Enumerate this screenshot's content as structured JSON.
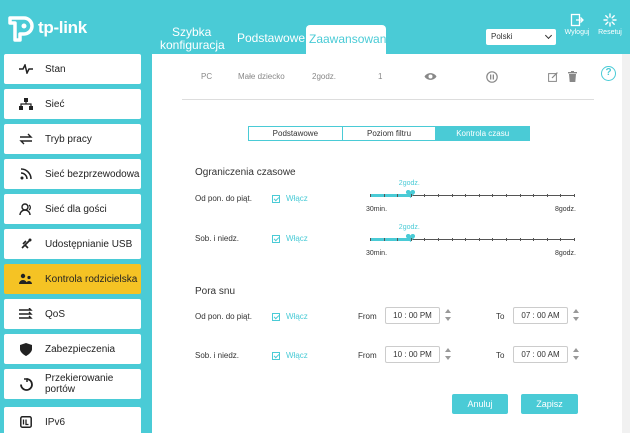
{
  "header": {
    "logo_text": "tp-link",
    "nav": {
      "quick_line1": "Szybka",
      "quick_line2": "konfiguracja",
      "basic": "Podstawowe",
      "advanced": "Zaawansowane"
    },
    "language": "Polski",
    "logout_label": "Wyloguj",
    "reboot_label": "Resetuj"
  },
  "sidebar": {
    "items": [
      {
        "label": "Stan",
        "icon": "pulse-icon"
      },
      {
        "label": "Sieć",
        "icon": "network-icon"
      },
      {
        "label": "Tryb pracy",
        "icon": "mode-icon"
      },
      {
        "label": "Sieć bezprzewodowa",
        "icon": "wifi-icon"
      },
      {
        "label": "Sieć dla gości",
        "icon": "guests-icon"
      },
      {
        "label": "Udostępnianie USB",
        "icon": "usb-icon"
      },
      {
        "label": "Kontrola rodzicielska",
        "icon": "parental-icon"
      },
      {
        "label": "QoS",
        "icon": "qos-icon"
      },
      {
        "label": "Zabezpieczenia",
        "icon": "shield-icon"
      },
      {
        "label_line1": "Przekierowanie",
        "label_line2": "portów",
        "icon": "forward-icon"
      },
      {
        "label": "IPv6",
        "icon": "ipv6-icon"
      }
    ],
    "active_index": 6
  },
  "table_row": {
    "device": "PC",
    "profile": "Małe dziecko",
    "time": "2godz.",
    "count": "1"
  },
  "tabs": [
    "Podstawowe",
    "Poziom filtru",
    "Kontrola czasu"
  ],
  "active_tab": 2,
  "time_limits": {
    "title": "Ograniczenia czasowe",
    "weekday": {
      "label": "Od pon. do piąt.",
      "enable_label": "Włącz",
      "enabled": true,
      "value_label": "2godz.",
      "value_hours": 2
    },
    "weekend": {
      "label": "Sob. i niedz.",
      "enable_label": "Włącz",
      "enabled": true,
      "value_label": "2godz.",
      "value_hours": 2
    },
    "min_label": "30min.",
    "max_label": "8godz.",
    "min_hours": 0.5,
    "max_hours": 8
  },
  "bedtime": {
    "title": "Pora snu",
    "from_label": "From",
    "to_label": "To",
    "weekday": {
      "label": "Od pon. do piąt.",
      "enable_label": "Włącz",
      "from": "10 : 00  PM",
      "to": "07 : 00  AM"
    },
    "weekend": {
      "label": "Sob. i niedz.",
      "enable_label": "Włącz",
      "from": "10 : 00  PM",
      "to": "07 : 00  AM"
    }
  },
  "buttons": {
    "cancel": "Anuluj",
    "save": "Zapisz"
  },
  "colors": {
    "accent": "#4acbd6",
    "active_menu": "#f5c324"
  }
}
